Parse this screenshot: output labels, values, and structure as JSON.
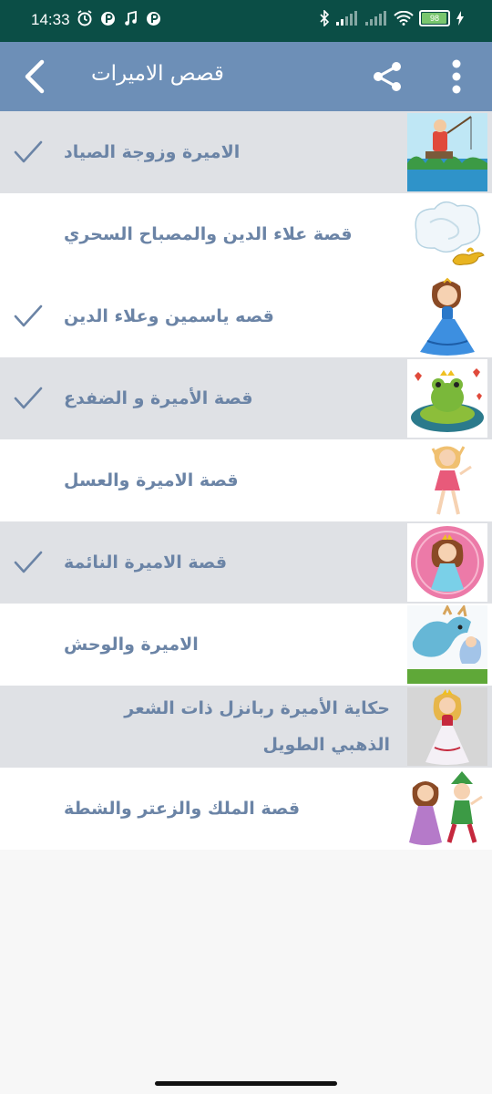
{
  "status_bar": {
    "time": "14:33",
    "battery_level": "98",
    "left_icons": [
      "alarm-icon",
      "media-icon",
      "music-icon",
      "media-icon"
    ],
    "right_icons": [
      "bluetooth-icon",
      "signal-icon",
      "signal-icon",
      "wifi-icon",
      "battery-icon",
      "charging-icon"
    ]
  },
  "toolbar": {
    "title": "قصص الاميرات",
    "back_icon": "chevron-left-icon",
    "share_icon": "share-icon",
    "menu_icon": "more-vertical-icon"
  },
  "stories": [
    {
      "title": "الاميرة وزوجة الصياد",
      "read": true,
      "thumb": "fisherman-thumb"
    },
    {
      "title": "قصة علاء الدين والمصباح السحري",
      "read": false,
      "thumb": "magic-lamp-thumb"
    },
    {
      "title": "قصه ياسمين وعلاء الدين",
      "read": true,
      "thumb": "princess-blue-dress-thumb"
    },
    {
      "title": "قصة الأميرة و الضفدع",
      "read": true,
      "thumb": "frog-thumb"
    },
    {
      "title": "قصة الاميرة والعسل",
      "read": false,
      "thumb": "fairy-thumb"
    },
    {
      "title": "قصة الاميرة النائمة",
      "read": true,
      "thumb": "princess-pink-thumb"
    },
    {
      "title": "الاميرة والوحش",
      "read": false,
      "thumb": "dragon-thumb"
    },
    {
      "title": "حكاية الأميرة ربانزل ذات الشعر الذهبي الطويل",
      "read": false,
      "thumb": "rapunzel-thumb"
    },
    {
      "title": "قصة الملك والزعتر والشطة",
      "read": false,
      "thumb": "king-and-girl-thumb"
    }
  ],
  "colors": {
    "status_bar": "#0b4e46",
    "toolbar": "#6d8fb7",
    "row_alt": "#dfe1e5",
    "title_text": "#6b84a6",
    "check": "#6b84a6"
  }
}
